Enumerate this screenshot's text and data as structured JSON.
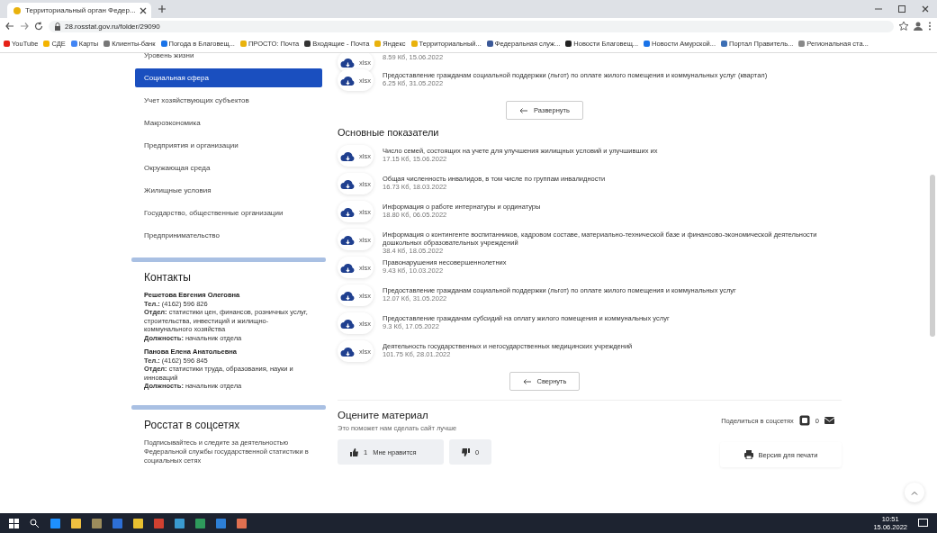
{
  "browser": {
    "tab_title": "Территориальный орган Федер...",
    "url": "28.rosstat.gov.ru/folder/29090",
    "bookmarks": [
      "YouTube",
      "СДЕ",
      "Карты",
      "Клиенты-банк",
      "Погода в Благовещ...",
      "ПРОСТО: Почта",
      "Входящие - Почта",
      "Яндекс",
      "Территориальный...",
      "Федеральная служ...",
      "Новости Благовещ...",
      "Новости Амурской...",
      "Портал Правитель...",
      "Региональная ста..."
    ]
  },
  "sidebar": {
    "nav": [
      {
        "label": "Уровень жизни",
        "selected": false
      },
      {
        "label": "Социальная сфера",
        "selected": true
      },
      {
        "label": "Учет хозяйствующих субъектов",
        "selected": false
      },
      {
        "label": "Макроэкономика",
        "selected": false
      },
      {
        "label": "Предприятия и организации",
        "selected": false
      },
      {
        "label": "Окружающая среда",
        "selected": false
      },
      {
        "label": "Жилищные условия",
        "selected": false
      },
      {
        "label": "Государство, общественные организации",
        "selected": false
      },
      {
        "label": "Предпринимательство",
        "selected": false
      }
    ],
    "contacts": {
      "title": "Контакты",
      "people": [
        {
          "name": "Решетова Евгения Олеговна",
          "phone": "**Тел.:** (4162) 596 826",
          "department": "**Отдел:** статистики цен, финансов, розничных услуг, строительства, инвестиций и жилищно-коммунального хозяйства",
          "position": "**Должность:** начальник отдела"
        },
        {
          "name": "Панова Елена Анатольевна",
          "phone": "**Тел.:** (4162) 596 845",
          "department": "**Отдел:** статистики труда, образования, науки и инноваций",
          "position": "**Должность:** начальник отдела"
        }
      ]
    },
    "social": {
      "title": "Росстат в соцсетях",
      "text": "Подписывайтесь и следите за деятельностью Федеральной службы государственной статистики в социальных сетях"
    }
  },
  "main": {
    "files": [
      {
        "format": "xlsx",
        "meta": "8.59 Кб, 15.06.2022"
      },
      {
        "format": "xlsx",
        "title": "Предоставление гражданам социальной поддержки (льгот) по оплате жилого помещения и коммунальных услуг (квартал)",
        "meta": "6.25 Кб, 31.05.2022"
      }
    ],
    "expand_button": "Развернуть",
    "section_title": "Основные показатели",
    "indicators": [
      {
        "format": "xlsx",
        "title": "Число семей, состоящих на учете для улучшения жилищных условий и улучшивших их",
        "meta": "17.15 Кб, 15.06.2022"
      },
      {
        "format": "xlsx",
        "title": "Общая численность инвалидов, в том числе по группам инвалидности",
        "meta": "16.73 Кб, 18.03.2022"
      },
      {
        "format": "xlsx",
        "title": "Информация о работе интернатуры и ординатуры",
        "meta": "18.80 Кб, 06.05.2022"
      },
      {
        "format": "xlsx",
        "title": "Информация о контингенте воспитанников, кадровом составе, материально-технической базе и финансово-экономической деятельности дошкольных образовательных учреждений",
        "meta": "38.4 Кб, 18.05.2022"
      },
      {
        "format": "xlsx",
        "title": "Правонарушения несовершеннолетних",
        "meta": "9.43 Кб, 10.03.2022"
      },
      {
        "format": "xlsx",
        "title": "Предоставление гражданам социальной поддержки (льгот) по оплате жилого помещения и коммунальных услуг",
        "meta": "12.07 Кб, 31.05.2022"
      },
      {
        "format": "xlsx",
        "title": "Предоставление гражданам субсидий на оплату жилого помещения и коммунальных услуг",
        "meta": "9.3 Кб, 17.05.2022"
      },
      {
        "format": "xlsx",
        "title": "Деятельность государственных и негосударственных медицинских учреждений",
        "meta": "101.75 Кб, 28.01.2022"
      }
    ],
    "collapse_button": "Свернуть",
    "rating": {
      "title": "Оцените материал",
      "subtitle": "Это поможет нам сделать сайт лучше",
      "share_label": "Поделиться в соцсетях",
      "share_count": "0",
      "like_count": "1",
      "like_label": "Мне нравится",
      "dislike_count": "0",
      "print_label": "Версия для печати"
    }
  },
  "taskbar": {
    "time": "10:51",
    "date": "15.06.2022"
  }
}
